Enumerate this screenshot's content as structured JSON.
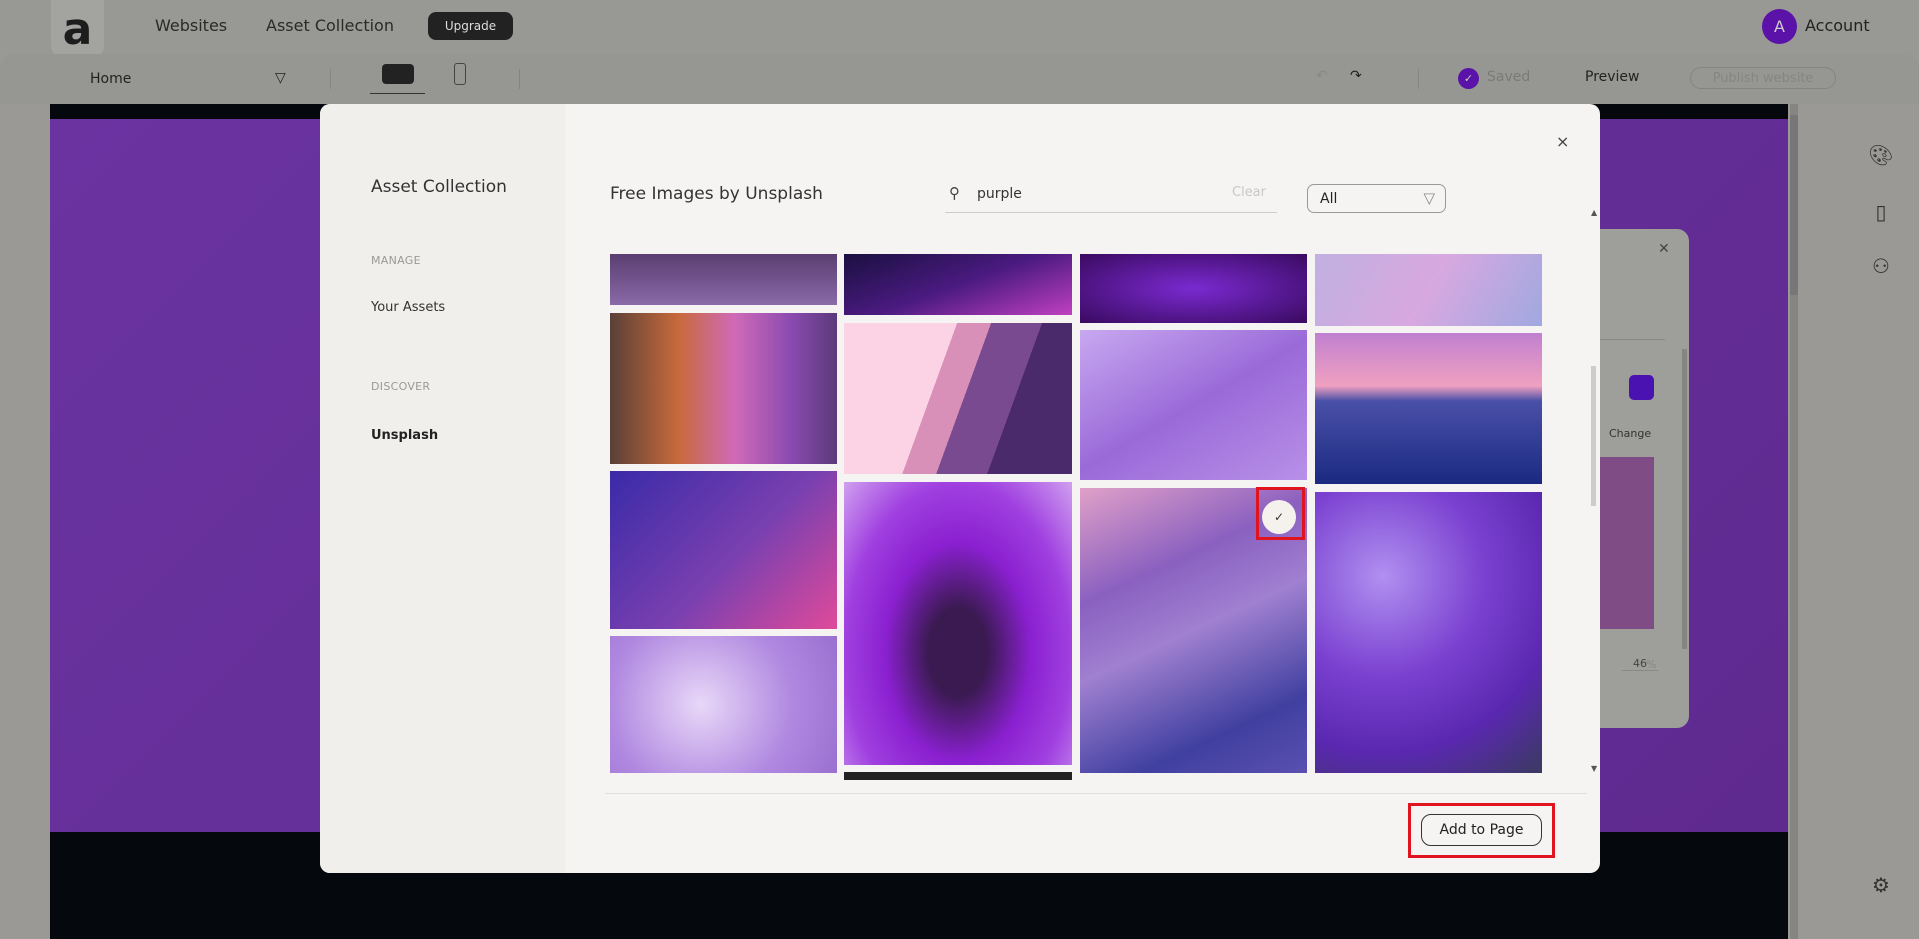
{
  "topnav": {
    "logo": "a",
    "links": [
      "Websites",
      "Asset Collection"
    ],
    "upgrade": "Upgrade",
    "avatar_initial": "A",
    "account": "Account"
  },
  "toolbar": {
    "page": "Home",
    "saved": "Saved",
    "preview": "Preview",
    "publish": "Publish website"
  },
  "side_panel": {
    "change": "Change",
    "opacity": "46",
    "percent": "%",
    "swatch_color": "#4a12b0"
  },
  "modal": {
    "sidebar": {
      "title": "Asset Collection",
      "sections": [
        {
          "heading": "MANAGE",
          "items": [
            "Your Assets"
          ]
        },
        {
          "heading": "DISCOVER",
          "items": [
            "Unsplash"
          ]
        }
      ]
    },
    "title": "Free Images by Unsplash",
    "search": {
      "value": "purple",
      "clear": "Clear"
    },
    "filter": {
      "selected": "All"
    },
    "close": "×",
    "add_button": "Add to Page",
    "selected_image": "misty-flower"
  },
  "colors": {
    "accent": "#5a12a8",
    "highlight": "#e0141e"
  }
}
